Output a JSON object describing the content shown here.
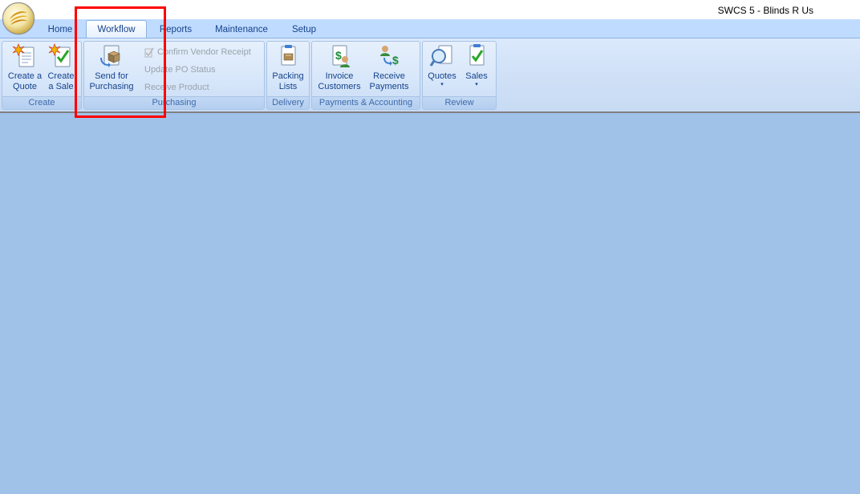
{
  "window": {
    "title": "SWCS 5 - Blinds R Us"
  },
  "tabs": [
    {
      "label": "Home"
    },
    {
      "label": "Workflow",
      "active": true
    },
    {
      "label": "Reports"
    },
    {
      "label": "Maintenance"
    },
    {
      "label": "Setup"
    }
  ],
  "ribbon": {
    "groups": {
      "create": {
        "label": "Create",
        "buttons": [
          {
            "label": "Create a Quote",
            "line1": "Create a",
            "line2": "Quote",
            "icon": "new-quote-icon"
          },
          {
            "label": "Create a Sale",
            "line1": "Create",
            "line2": "a Sale",
            "icon": "new-sale-icon"
          }
        ]
      },
      "purchasing": {
        "label": "Purchasing",
        "buttons": [
          {
            "label": "Send for Purchasing",
            "line1": "Send for",
            "line2": "Purchasing",
            "icon": "send-purchasing-icon"
          }
        ],
        "small_buttons": [
          {
            "label": "Confirm Vendor Receipt",
            "enabled": false,
            "icon": "confirm-receipt-icon"
          },
          {
            "label": "Update PO Status",
            "enabled": false
          },
          {
            "label": "Receive Product",
            "enabled": false
          }
        ]
      },
      "delivery": {
        "label": "Delivery",
        "buttons": [
          {
            "label": "Packing Lists",
            "line1": "Packing",
            "line2": "Lists",
            "icon": "packing-list-icon"
          }
        ]
      },
      "payments": {
        "label": "Payments & Accounting",
        "buttons": [
          {
            "label": "Invoice Customers",
            "line1": "Invoice",
            "line2": "Customers",
            "icon": "invoice-icon"
          },
          {
            "label": "Receive Payments",
            "line1": "Receive",
            "line2": "Payments",
            "icon": "payment-icon"
          }
        ]
      },
      "review": {
        "label": "Review",
        "buttons": [
          {
            "label": "Quotes",
            "icon": "search-quotes-icon",
            "dropdown": true
          },
          {
            "label": "Sales",
            "icon": "sales-review-icon",
            "dropdown": true
          }
        ]
      }
    }
  },
  "dropdown_glyph": "▾",
  "colors": {
    "workspace": "#a1c2e8",
    "highlight": "#ff0000",
    "accent_text": "#15428b"
  }
}
